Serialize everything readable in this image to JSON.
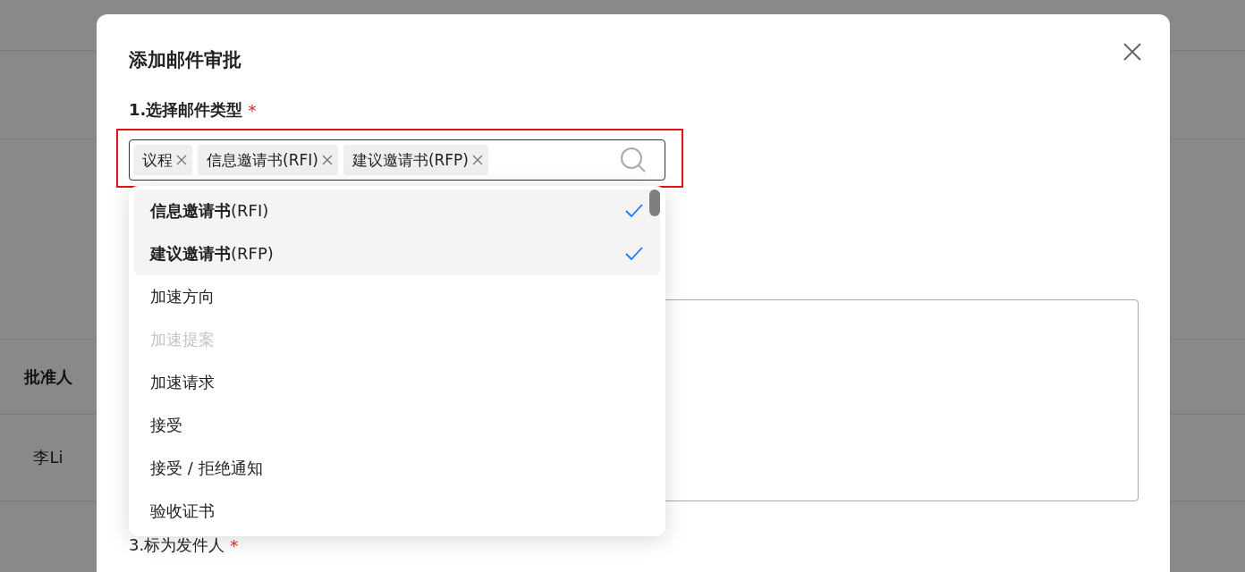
{
  "background": {
    "table_header": "批准人",
    "table_cell": "李Li"
  },
  "dialog": {
    "title": "添加邮件审批",
    "field_1": {
      "label": "1.选择邮件类型",
      "required_mark": "*",
      "tags": [
        {
          "label": "议程"
        },
        {
          "label": "信息邀请书(RFI)"
        },
        {
          "label": "建议邀请书(RFP)"
        }
      ]
    },
    "options": [
      {
        "label": "**信息邀请书**(RFI)",
        "selected": true,
        "disabled": false
      },
      {
        "label": "**建议邀请书**(RFP)",
        "selected": true,
        "disabled": false
      },
      {
        "label": "加速方向",
        "selected": false,
        "disabled": false
      },
      {
        "label": "加速提案",
        "selected": false,
        "disabled": true
      },
      {
        "label": "加速请求",
        "selected": false,
        "disabled": false
      },
      {
        "label": "接受",
        "selected": false,
        "disabled": false
      },
      {
        "label": "接受 / 拒绝通知",
        "selected": false,
        "disabled": false
      },
      {
        "label": "验收证书",
        "selected": false,
        "disabled": false
      }
    ],
    "field_3": {
      "label": "3.标为发件人",
      "required_mark": "*"
    }
  }
}
